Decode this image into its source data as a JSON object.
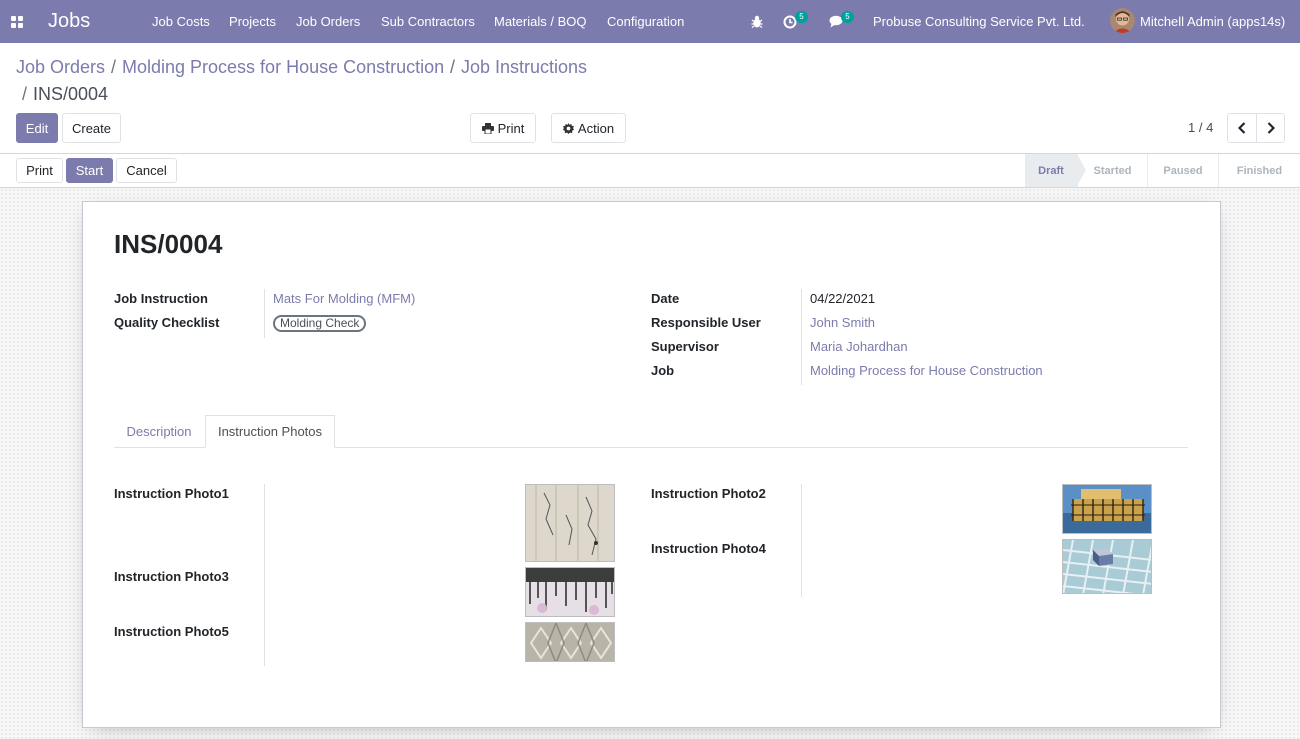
{
  "navbar": {
    "app_name": "Jobs",
    "menu": [
      "Job Costs",
      "Projects",
      "Job Orders",
      "Sub Contractors",
      "Materials / BOQ",
      "Configuration"
    ],
    "activity_count": "5",
    "message_count": "5",
    "company": "Probuse Consulting Service Pvt. Ltd.",
    "user": "Mitchell Admin (apps14s)"
  },
  "breadcrumb": {
    "items": [
      "Job Orders",
      "Molding Process for House Construction",
      "Job Instructions"
    ],
    "separator": "/",
    "current": "INS/0004"
  },
  "toolbar": {
    "edit": "Edit",
    "create": "Create",
    "print": "Print",
    "action": "Action",
    "pager": "1 / 4"
  },
  "statusbar": {
    "buttons": {
      "print": "Print",
      "start": "Start",
      "cancel": "Cancel"
    },
    "stages": [
      "Draft",
      "Started",
      "Paused",
      "Finished"
    ],
    "active_stage": "Draft"
  },
  "record": {
    "name": "INS/0004",
    "left": {
      "job_instruction_label": "Job Instruction",
      "job_instruction": "Mats For Molding (MFM)",
      "quality_checklist_label": "Quality Checklist",
      "quality_checklist": "Molding Check"
    },
    "right": {
      "date_label": "Date",
      "date": "04/22/2021",
      "responsible_label": "Responsible User",
      "responsible": "John Smith",
      "supervisor_label": "Supervisor",
      "supervisor": "Maria Johardhan",
      "job_label": "Job",
      "job": "Molding Process for House Construction"
    }
  },
  "tabs": {
    "description": "Description",
    "photos": "Instruction Photos",
    "active": "Instruction Photos"
  },
  "photos": {
    "photo1": "Instruction Photo1",
    "photo2": "Instruction Photo2",
    "photo3": "Instruction Photo3",
    "photo4": "Instruction Photo4",
    "photo5": "Instruction Photo5"
  },
  "colors": {
    "brand": "#7c7bad",
    "badge": "#00a09d"
  }
}
